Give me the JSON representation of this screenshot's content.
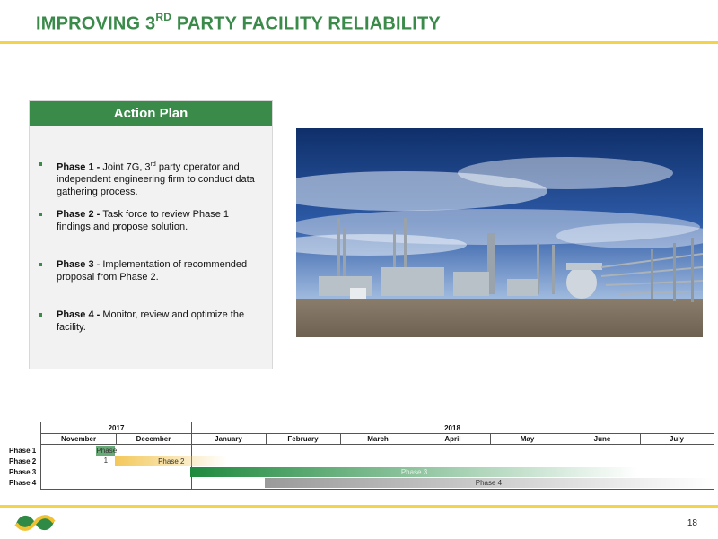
{
  "header": {
    "title_prefix": "IMPROVING 3",
    "title_sup": "RD",
    "title_suffix": " PARTY FACILITY RELIABILITY"
  },
  "action_plan": {
    "heading": "Action Plan",
    "items": [
      {
        "label": "Phase 1  - ",
        "text_before_sup": "Joint 7G, 3",
        "sup": "rd",
        "text_after_sup": " party operator and independent engineering firm to conduct data gathering process."
      },
      {
        "label": "Phase 2  - ",
        "text_before_sup": "Task force to review Phase 1 findings and propose solution.",
        "sup": "",
        "text_after_sup": ""
      },
      {
        "label": "Phase 3  - ",
        "text_before_sup": "Implementation of recommended proposal from Phase 2.",
        "sup": "",
        "text_after_sup": ""
      },
      {
        "label": "Phase 4  - ",
        "text_before_sup": "Monitor, review and optimize the facility.",
        "sup": "",
        "text_after_sup": ""
      }
    ]
  },
  "gantt": {
    "years": [
      "2017",
      "2018"
    ],
    "months": [
      "November",
      "December",
      "January",
      "February",
      "March",
      "April",
      "May",
      "June",
      "July"
    ],
    "phases": [
      {
        "label": "Phase 1",
        "bar_label": "Phase 1",
        "start_month": 0.75,
        "end_month": 1.0,
        "color": "#6aaa78"
      },
      {
        "label": "Phase 2",
        "bar_label": "Phase 2",
        "start_month": 1.0,
        "end_month": 2.5,
        "color": "#f3c85a"
      },
      {
        "label": "Phase 3",
        "bar_label": "Phase 3",
        "start_month": 2.0,
        "end_month": 8.0,
        "color": "#1f8a3e"
      },
      {
        "label": "Phase 4",
        "bar_label": "Phase 4",
        "start_month": 3.0,
        "end_month": 9.0,
        "color": "#9a9a9a"
      }
    ]
  },
  "footer": {
    "page_number": "18"
  },
  "colors": {
    "brand_green": "#3a8a4a",
    "accent_yellow": "#f3d34a"
  }
}
